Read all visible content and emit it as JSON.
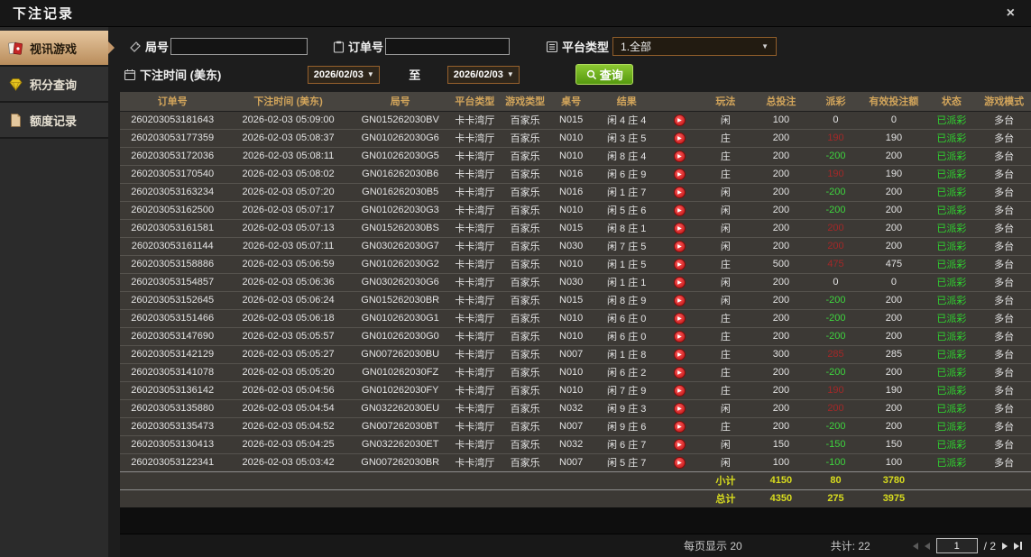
{
  "window": {
    "title": "下注记录",
    "close_label": "×"
  },
  "sidebar": {
    "items": [
      {
        "label": "视讯游戏",
        "icon": "cards-icon",
        "active": true
      },
      {
        "label": "积分查询",
        "icon": "gem-icon",
        "active": false
      },
      {
        "label": "额度记录",
        "icon": "document-icon",
        "active": false
      }
    ]
  },
  "filters": {
    "round_label": "局号",
    "round_value": "",
    "order_label": "订单号",
    "order_value": "",
    "platform_label": "平台类型",
    "platform_value": "1.全部",
    "time_label": "下注时间 (美东)",
    "date_from": "2026/02/03",
    "to_label": "至",
    "date_to": "2026/02/03",
    "query_label": "查询"
  },
  "table": {
    "headers": [
      {
        "key": "order",
        "label": "订单号"
      },
      {
        "key": "time",
        "label": "下注时间 (美东)"
      },
      {
        "key": "round",
        "label": "局号"
      },
      {
        "key": "platform",
        "label": "平台类型"
      },
      {
        "key": "game",
        "label": "游戏类型"
      },
      {
        "key": "table",
        "label": "桌号"
      },
      {
        "key": "result",
        "label": "结果"
      },
      {
        "key": "video",
        "label": ""
      },
      {
        "key": "method",
        "label": "玩法"
      },
      {
        "key": "total",
        "label": "总投注"
      },
      {
        "key": "payout",
        "label": "派彩"
      },
      {
        "key": "valid",
        "label": "有效投注额"
      },
      {
        "key": "status",
        "label": "状态"
      },
      {
        "key": "mode",
        "label": "游戏模式"
      }
    ],
    "rows": [
      {
        "order": "260203053181643",
        "time": "2026-02-03 05:09:00",
        "round": "GN015262030BV",
        "platform": "卡卡湾厅",
        "game": "百家乐",
        "table": "N015",
        "result": "闲 4 庄 4",
        "method": "闲",
        "total": "100",
        "payout": "0",
        "pc": "zero",
        "valid": "0",
        "status": "已派彩",
        "mode": "多台"
      },
      {
        "order": "260203053177359",
        "time": "2026-02-03 05:08:37",
        "round": "GN010262030G6",
        "platform": "卡卡湾厅",
        "game": "百家乐",
        "table": "N010",
        "result": "闲 3 庄 5",
        "method": "庄",
        "total": "200",
        "payout": "190",
        "pc": "pos",
        "valid": "190",
        "status": "已派彩",
        "mode": "多台"
      },
      {
        "order": "260203053172036",
        "time": "2026-02-03 05:08:11",
        "round": "GN010262030G5",
        "platform": "卡卡湾厅",
        "game": "百家乐",
        "table": "N010",
        "result": "闲 8 庄 4",
        "method": "庄",
        "total": "200",
        "payout": "-200",
        "pc": "neg",
        "valid": "200",
        "status": "已派彩",
        "mode": "多台"
      },
      {
        "order": "260203053170540",
        "time": "2026-02-03 05:08:02",
        "round": "GN016262030B6",
        "platform": "卡卡湾厅",
        "game": "百家乐",
        "table": "N016",
        "result": "闲 6 庄 9",
        "method": "庄",
        "total": "200",
        "payout": "190",
        "pc": "pos",
        "valid": "190",
        "status": "已派彩",
        "mode": "多台"
      },
      {
        "order": "260203053163234",
        "time": "2026-02-03 05:07:20",
        "round": "GN016262030B5",
        "platform": "卡卡湾厅",
        "game": "百家乐",
        "table": "N016",
        "result": "闲 1 庄 7",
        "method": "闲",
        "total": "200",
        "payout": "-200",
        "pc": "neg",
        "valid": "200",
        "status": "已派彩",
        "mode": "多台"
      },
      {
        "order": "260203053162500",
        "time": "2026-02-03 05:07:17",
        "round": "GN010262030G3",
        "platform": "卡卡湾厅",
        "game": "百家乐",
        "table": "N010",
        "result": "闲 5 庄 6",
        "method": "闲",
        "total": "200",
        "payout": "-200",
        "pc": "neg",
        "valid": "200",
        "status": "已派彩",
        "mode": "多台"
      },
      {
        "order": "260203053161581",
        "time": "2026-02-03 05:07:13",
        "round": "GN015262030BS",
        "platform": "卡卡湾厅",
        "game": "百家乐",
        "table": "N015",
        "result": "闲 8 庄 1",
        "method": "闲",
        "total": "200",
        "payout": "200",
        "pc": "pos",
        "valid": "200",
        "status": "已派彩",
        "mode": "多台"
      },
      {
        "order": "260203053161144",
        "time": "2026-02-03 05:07:11",
        "round": "GN030262030G7",
        "platform": "卡卡湾厅",
        "game": "百家乐",
        "table": "N030",
        "result": "闲 7 庄 5",
        "method": "闲",
        "total": "200",
        "payout": "200",
        "pc": "pos",
        "valid": "200",
        "status": "已派彩",
        "mode": "多台"
      },
      {
        "order": "260203053158886",
        "time": "2026-02-03 05:06:59",
        "round": "GN010262030G2",
        "platform": "卡卡湾厅",
        "game": "百家乐",
        "table": "N010",
        "result": "闲 1 庄 5",
        "method": "庄",
        "total": "500",
        "payout": "475",
        "pc": "pos",
        "valid": "475",
        "status": "已派彩",
        "mode": "多台"
      },
      {
        "order": "260203053154857",
        "time": "2026-02-03 05:06:36",
        "round": "GN030262030G6",
        "platform": "卡卡湾厅",
        "game": "百家乐",
        "table": "N030",
        "result": "闲 1 庄 1",
        "method": "闲",
        "total": "200",
        "payout": "0",
        "pc": "zero",
        "valid": "0",
        "status": "已派彩",
        "mode": "多台"
      },
      {
        "order": "260203053152645",
        "time": "2026-02-03 05:06:24",
        "round": "GN015262030BR",
        "platform": "卡卡湾厅",
        "game": "百家乐",
        "table": "N015",
        "result": "闲 8 庄 9",
        "method": "闲",
        "total": "200",
        "payout": "-200",
        "pc": "neg",
        "valid": "200",
        "status": "已派彩",
        "mode": "多台"
      },
      {
        "order": "260203053151466",
        "time": "2026-02-03 05:06:18",
        "round": "GN010262030G1",
        "platform": "卡卡湾厅",
        "game": "百家乐",
        "table": "N010",
        "result": "闲 6 庄 0",
        "method": "庄",
        "total": "200",
        "payout": "-200",
        "pc": "neg",
        "valid": "200",
        "status": "已派彩",
        "mode": "多台"
      },
      {
        "order": "260203053147690",
        "time": "2026-02-03 05:05:57",
        "round": "GN010262030G0",
        "platform": "卡卡湾厅",
        "game": "百家乐",
        "table": "N010",
        "result": "闲 6 庄 0",
        "method": "庄",
        "total": "200",
        "payout": "-200",
        "pc": "neg",
        "valid": "200",
        "status": "已派彩",
        "mode": "多台"
      },
      {
        "order": "260203053142129",
        "time": "2026-02-03 05:05:27",
        "round": "GN007262030BU",
        "platform": "卡卡湾厅",
        "game": "百家乐",
        "table": "N007",
        "result": "闲 1 庄 8",
        "method": "庄",
        "total": "300",
        "payout": "285",
        "pc": "pos",
        "valid": "285",
        "status": "已派彩",
        "mode": "多台"
      },
      {
        "order": "260203053141078",
        "time": "2026-02-03 05:05:20",
        "round": "GN010262030FZ",
        "platform": "卡卡湾厅",
        "game": "百家乐",
        "table": "N010",
        "result": "闲 6 庄 2",
        "method": "庄",
        "total": "200",
        "payout": "-200",
        "pc": "neg",
        "valid": "200",
        "status": "已派彩",
        "mode": "多台"
      },
      {
        "order": "260203053136142",
        "time": "2026-02-03 05:04:56",
        "round": "GN010262030FY",
        "platform": "卡卡湾厅",
        "game": "百家乐",
        "table": "N010",
        "result": "闲 7 庄 9",
        "method": "庄",
        "total": "200",
        "payout": "190",
        "pc": "pos",
        "valid": "190",
        "status": "已派彩",
        "mode": "多台"
      },
      {
        "order": "260203053135880",
        "time": "2026-02-03 05:04:54",
        "round": "GN032262030EU",
        "platform": "卡卡湾厅",
        "game": "百家乐",
        "table": "N032",
        "result": "闲 9 庄 3",
        "method": "闲",
        "total": "200",
        "payout": "200",
        "pc": "pos",
        "valid": "200",
        "status": "已派彩",
        "mode": "多台"
      },
      {
        "order": "260203053135473",
        "time": "2026-02-03 05:04:52",
        "round": "GN007262030BT",
        "platform": "卡卡湾厅",
        "game": "百家乐",
        "table": "N007",
        "result": "闲 9 庄 6",
        "method": "庄",
        "total": "200",
        "payout": "-200",
        "pc": "neg",
        "valid": "200",
        "status": "已派彩",
        "mode": "多台"
      },
      {
        "order": "260203053130413",
        "time": "2026-02-03 05:04:25",
        "round": "GN032262030ET",
        "platform": "卡卡湾厅",
        "game": "百家乐",
        "table": "N032",
        "result": "闲 6 庄 7",
        "method": "闲",
        "total": "150",
        "payout": "-150",
        "pc": "neg",
        "valid": "150",
        "status": "已派彩",
        "mode": "多台"
      },
      {
        "order": "260203053122341",
        "time": "2026-02-03 05:03:42",
        "round": "GN007262030BR",
        "platform": "卡卡湾厅",
        "game": "百家乐",
        "table": "N007",
        "result": "闲 5 庄 7",
        "method": "闲",
        "total": "100",
        "payout": "-100",
        "pc": "neg",
        "valid": "100",
        "status": "已派彩",
        "mode": "多台"
      }
    ],
    "subtotal": {
      "label": "小计",
      "total": "4150",
      "payout": "80",
      "valid": "3780"
    },
    "grand_total": {
      "label": "总计",
      "total": "4350",
      "payout": "275",
      "valid": "3975"
    }
  },
  "footer": {
    "per_page": "每页显示 20",
    "total": "共计: 22",
    "page": "1",
    "page_suffix": "/ 2"
  },
  "colors": {
    "accent_tan": "#c99d6e",
    "header_gold": "#d2a55b",
    "win_red": "#a32828",
    "loss_green": "#3ed43e",
    "status_green": "#2fd42f",
    "summary_yellow": "#d8dc1e",
    "query_green": "#6fb320"
  }
}
